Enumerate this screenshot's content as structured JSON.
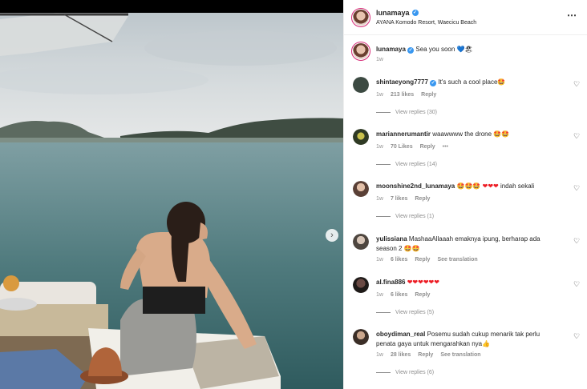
{
  "post": {
    "username": "lunamaya",
    "location": "AYANA Komodo Resort, Waecicu Beach",
    "caption": "Sea you soon",
    "caption_emoji": "💙🏖",
    "caption_time": "1w",
    "more_icon": "⋯"
  },
  "comments": [
    {
      "username": "shintaeyong7777",
      "verified": true,
      "text": "It's such a cool place",
      "emoji": "🤩",
      "time": "1w",
      "likes": "213 likes",
      "reply": "Reply",
      "view_replies": "View replies (30)"
    },
    {
      "username": "mariannerumantir",
      "verified": false,
      "text": "waawwww the drone",
      "emoji": "🤩🤩",
      "time": "1w",
      "likes": "70 Likes",
      "reply": "Reply",
      "extra": "•••",
      "view_replies": "View replies (14)"
    },
    {
      "username": "moonshine2nd_lunamaya",
      "verified": false,
      "text": "indah sekali",
      "emoji": "🤩🤩🤩",
      "hearts": "❤❤❤",
      "time": "1w",
      "likes": "7 likes",
      "reply": "Reply",
      "view_replies": "View replies (1)"
    },
    {
      "username": "yulissiana",
      "verified": false,
      "text": "MashaaAllaaah emaknya ipung, berharap ada season 2",
      "emoji": "🤩🤩",
      "time": "1w",
      "likes": "6 likes",
      "reply": "Reply",
      "see_translation": "See translation"
    },
    {
      "username": "al.fina886",
      "verified": false,
      "hearts": "❤❤❤❤❤❤",
      "time": "1w",
      "likes": "6 likes",
      "reply": "Reply",
      "view_replies": "View replies (5)"
    },
    {
      "username": "oboydiman_real",
      "verified": false,
      "text": "Posemu sudah cukup menarik tak perlu penata gaya untuk mengarahkan nya",
      "emoji": "👍",
      "time": "1w",
      "likes": "28 likes",
      "reply": "Reply",
      "see_translation": "See translation",
      "view_replies": "View replies (6)"
    }
  ],
  "icons": {
    "heart": "♡",
    "next": "›",
    "verified": "✓"
  },
  "colors": {
    "verified_blue": "#3897f0",
    "muted_text": "#8e8e8e",
    "story_ring": "#d62976"
  }
}
